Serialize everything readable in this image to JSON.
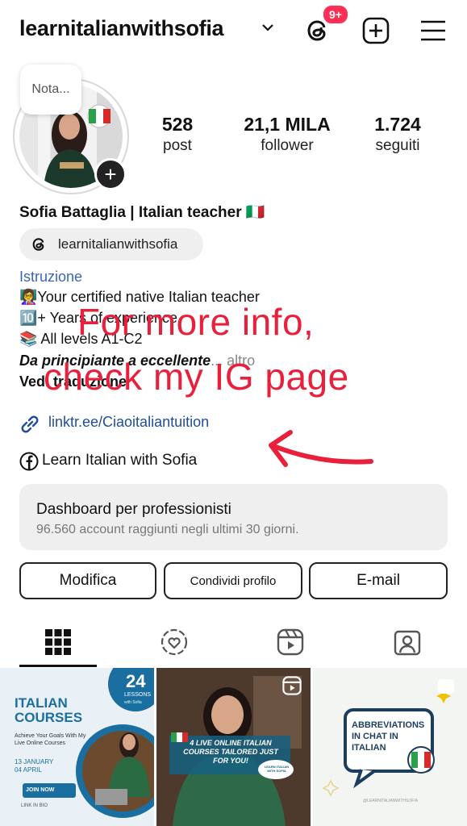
{
  "header": {
    "username": "learnitalianwithsofia",
    "notif_count": "9+"
  },
  "profile": {
    "note": "Nota...",
    "stats": [
      {
        "value": "528",
        "label": "post"
      },
      {
        "value": "21,1 MILA",
        "label": "follower"
      },
      {
        "value": "1.724",
        "label": "seguiti"
      }
    ],
    "name": "Sofia Battaglia | Italian teacher 🇮🇹",
    "threads_handle": "learnitalianwithsofia",
    "category": "Istruzione",
    "bio": [
      "👩‍🏫Your certified native Italian teacher",
      "🔟+ Years of experience",
      "📚 All levels A1-C2"
    ],
    "bio_italic": "Da principiante a eccellente",
    "bio_more": "... altro",
    "translation": "Vedi traduzione",
    "link": "linktr.ee/Ciaoitaliantuition",
    "facebook": "Learn Italian with Sofia"
  },
  "dashboard": {
    "title": "Dashboard per professionisti",
    "subtitle": "96.560 account raggiunti negli ultimi 30 giorni."
  },
  "actions": {
    "edit": "Modifica",
    "share": "Condividi profilo",
    "email": "E-mail"
  },
  "overlay": {
    "line1": "For more info,",
    "line2": "check my IG page"
  },
  "grid": {
    "post1": {
      "lessons_num": "24",
      "lessons_word": "LESSONS",
      "lessons_sub": "with Sofia",
      "title1": "ITALIAN",
      "title2": "COURSES",
      "tagline": "Achieve Your Goals With My Live Online Courses",
      "date1": "13 JANUARY",
      "date2": "04 APRIL",
      "cta": "JOIN NOW",
      "footer": "LINK IN BIO"
    },
    "post2": {
      "caption": "4 LIVE ONLINE ITALIAN COURSES TAILORED JUST FOR YOU!",
      "badge": "LEARN ITALIAN WITH SOFIA"
    },
    "post3": {
      "title": "ABBREVIATIONS IN CHAT IN ITALIAN",
      "footer": "@LEARNITALIANWITHSOFIA"
    }
  }
}
